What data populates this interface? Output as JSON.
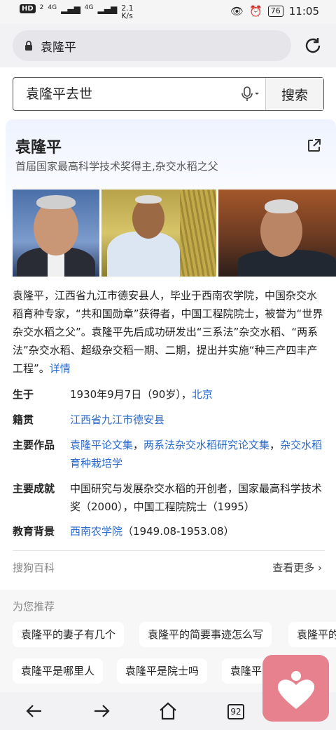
{
  "status_bar": {
    "hd": "HD",
    "sim": "2",
    "signal1": "4G",
    "signal2": "4G",
    "speed_value": "2.1",
    "speed_unit": "K/s",
    "battery": "76",
    "time": "11:05"
  },
  "address_bar": {
    "url_text": "袁隆平"
  },
  "search": {
    "query": "袁隆平去世",
    "button_label": "搜索"
  },
  "card": {
    "name": "袁隆平",
    "subtitle": "首届国家最高科学技术奖得主,杂交水稻之父",
    "description": "袁隆平，江西省九江市德安县人，毕业于西南农学院，中国杂交水稻育种专家，“共和国勋章”获得者，中国工程院院士，被誉为“世界杂交水稻之父”。袁隆平先后成功研发出“三系法”杂交水稻、“两系法”杂交水稻、超级杂交稻一期、二期，提出并实施“种三产四丰产工程”。",
    "details_link": "详情",
    "info": {
      "born_label": "生于",
      "born_text": "1930年9月7日（90岁），",
      "born_place": "北京",
      "origin_label": "籍贯",
      "origin_value": "江西省九江市德安县",
      "works_label": "主要作品",
      "works_1": "袁隆平论文集",
      "works_sep1": "，",
      "works_2": "两系法杂交水稻研究论文集",
      "works_sep2": "，",
      "works_3": "杂交水稻育种栽培学",
      "achieve_label": "主要成就",
      "achieve_value": "中国研究与发展杂交水稻的开创者，国家最高科学技术奖（2000），中国工程院院士（1995）",
      "edu_label": "教育背景",
      "edu_school": "西南农学院",
      "edu_period": "（1949.08-1953.08）"
    },
    "source": "搜狗百科",
    "more": "查看更多"
  },
  "recommend": {
    "title": "为您推荐",
    "chips_row1": [
      "袁隆平的妻子有几个",
      "袁隆平的简要事迹怎么写",
      "袁隆平的"
    ],
    "chips_row2": [
      "袁隆平是哪里人",
      "袁隆平是院士吗",
      "袁隆平"
    ]
  },
  "bottom_nav": {
    "tab_count": "92"
  },
  "colors": {
    "link": "#2a6acb",
    "floating_app": "#e6818d"
  }
}
